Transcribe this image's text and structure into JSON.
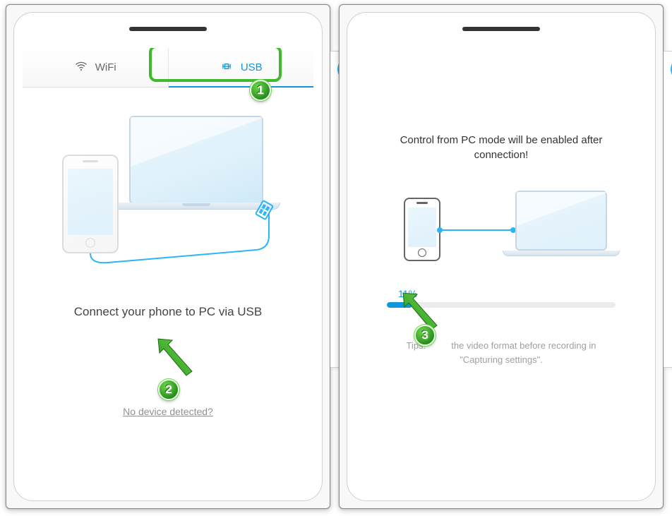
{
  "left": {
    "tabs": {
      "wifi": {
        "label": "WiFi"
      },
      "usb": {
        "label": "USB",
        "active": true
      }
    },
    "main_text": "Connect your phone to PC via USB",
    "no_device_link": "No device detected?"
  },
  "right": {
    "title": "Control from PC mode will be enabled after connection!",
    "progress": {
      "percent_label": "11%",
      "percent": 11
    },
    "tips_prefix": "Tips:",
    "tips_rest": "the video format before recording in \"Capturing settings\"."
  },
  "sidebar": {
    "avatar": "user",
    "items": [
      "expand-icon",
      "camera-icon",
      "record-icon",
      "brush-icon",
      "keyboard-icon",
      "settings-icon",
      "headset-icon"
    ]
  },
  "steps": {
    "s1": "1",
    "s2": "2",
    "s3": "3"
  },
  "colors": {
    "accent": "#1296db",
    "green": "#3fba2d"
  }
}
